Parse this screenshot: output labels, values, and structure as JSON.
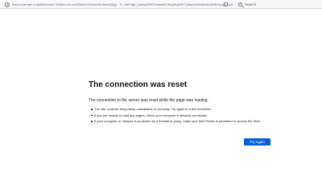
{
  "browser": {
    "url": "www.example.com/800/overr?Wdha=Vk-vmE6Wvd?dSrw2Wn9/e4tQQp...R_HhlYiq8_badwyEBSYMawh9-f2rg0bqshhTQ5sp3GWhhl9kv9Hfl2opqer&s8",
    "search_placeholder": "Search"
  },
  "error": {
    "title": "The connection was reset",
    "lead": "The connection to the server was reset while the page was loading.",
    "items": [
      "The site could be temporarily unavailable or too busy. Try again in a few moments.",
      "If you are unable to load any pages, check your computer’s network connection.",
      "If your computer or network is protected by a firewall or proxy, make sure that Firefox is permitted to access the Web."
    ],
    "try_again_label": "Try Again"
  },
  "colors": {
    "accent": "#0061e0",
    "text": "#15141a",
    "toolbar_bg": "#f9f9fb"
  }
}
